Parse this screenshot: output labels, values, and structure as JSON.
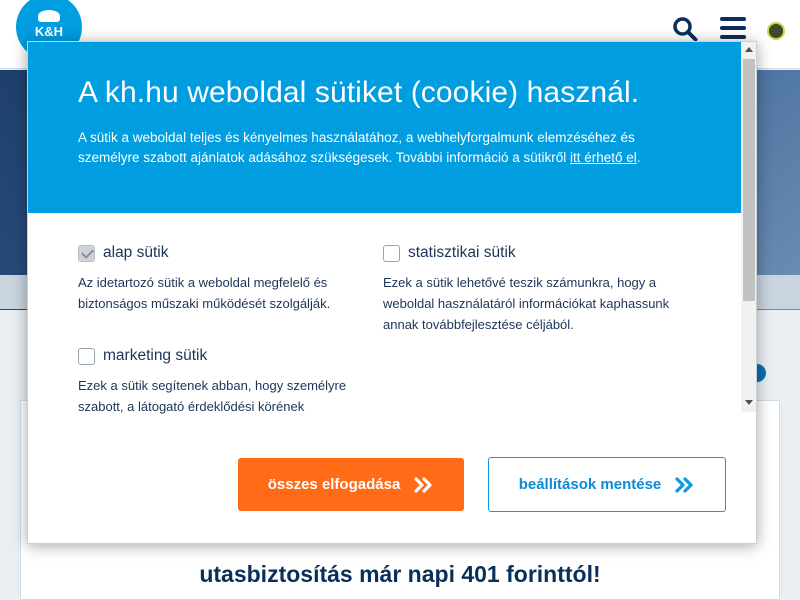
{
  "background": {
    "logo_text": "K&H",
    "headline": "utasbiztosítás már napi 401 forinttól!"
  },
  "modal": {
    "title": "A kh.hu weboldal sütiket (cookie) használ.",
    "description_before": "A sütik a weboldal teljes és kényelmes használatához, a webhelyforgalmunk elemzéséhez és személyre szabott ajánlatok adásához szükségesek. További információ a sütikről ",
    "description_link": "itt érhető el",
    "description_after": ".",
    "options": [
      {
        "label": "alap sütik",
        "checked": true,
        "disabled": true,
        "description": "Az idetartozó sütik a weboldal megfelelő és biztonságos műszaki működését szolgálják."
      },
      {
        "label": "statisztikai sütik",
        "checked": false,
        "description": "Ezek a sütik lehetővé teszik számunkra, hogy a weboldal használatáról információkat kaphassunk annak továbbfejlesztése céljából."
      },
      {
        "label": "marketing sütik",
        "checked": false,
        "description": "Ezek a sütik segítenek abban, hogy személyre szabott, a látogató érdeklődési körének"
      }
    ],
    "accept_all_label": "összes elfogadása",
    "save_settings_label": "beállítások mentése"
  },
  "colors": {
    "header_blue": "#009de0",
    "accept_orange": "#ff6b16",
    "navy_text": "#0b2f5b"
  },
  "icons": [
    "search-icon",
    "menu-icon",
    "accessibility-icon",
    "double-chevron-right-icon",
    "plus-circle-icon"
  ]
}
